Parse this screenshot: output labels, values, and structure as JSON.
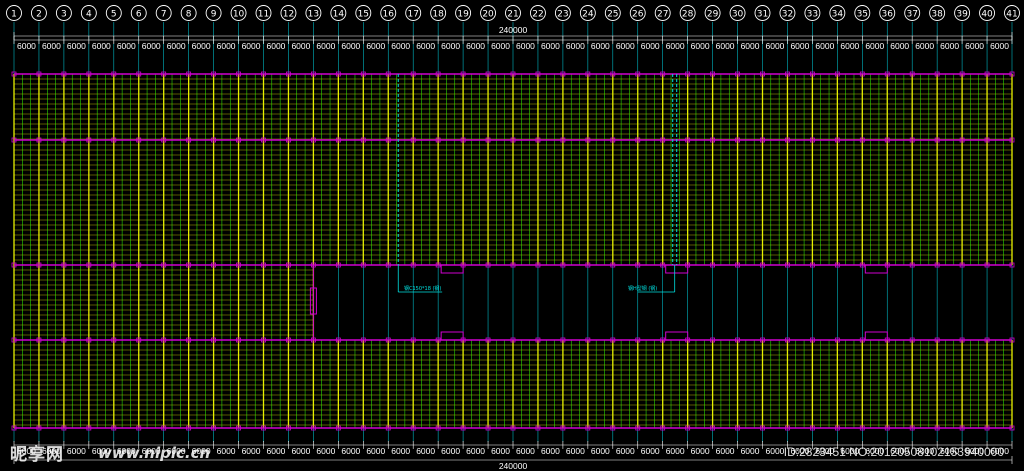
{
  "colors": {
    "background": "#000000",
    "axis_line": "#00b7c3",
    "axis_bubble": "#ffffff",
    "yellow": "#e8f000",
    "green": "#33ff00",
    "magenta": "#d000d0",
    "cyan": "#00e0e0",
    "dimension_text": "#ffffff"
  },
  "axis_labels": [
    "1",
    "2",
    "3",
    "4",
    "5",
    "6",
    "7",
    "8",
    "9",
    "10",
    "11",
    "12",
    "13",
    "14",
    "15",
    "16",
    "17",
    "18",
    "19",
    "20",
    "21",
    "22",
    "23",
    "24",
    "25",
    "26",
    "27",
    "28",
    "29",
    "30",
    "31",
    "32",
    "33",
    "34",
    "35",
    "36",
    "37",
    "38",
    "39",
    "40",
    "41"
  ],
  "bay_dimension": "6000",
  "total_dimension": "240000",
  "annotations": {
    "left": "钢C150*18 (钢)",
    "right": "钢H型钢 (钢)"
  },
  "watermark": {
    "logo": "昵享网",
    "url": "www.nipic.cn",
    "id_text": "ID:2823451 NO:20120508102153940000"
  }
}
